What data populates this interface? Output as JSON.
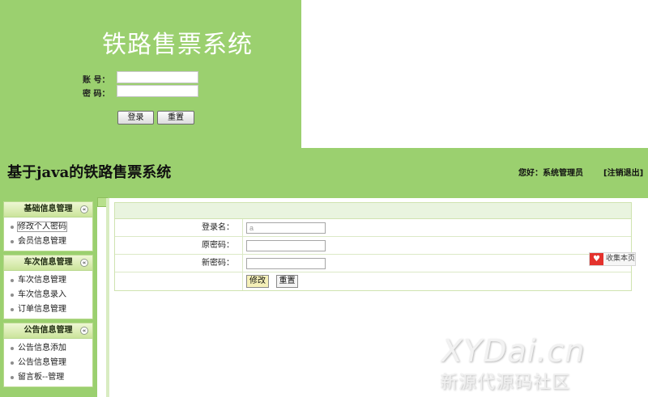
{
  "login": {
    "title": "铁路售票系统",
    "account_label": "账 号：",
    "password_label": "密 码：",
    "account_value": "",
    "password_value": "",
    "login_button": "登录",
    "reset_button": "重置"
  },
  "header": {
    "app_title": "基于java的铁路售票系统",
    "greeting": "您好：系统管理员",
    "logout": "[注销退出]"
  },
  "sidebar": {
    "groups": [
      {
        "title": "基础信息管理",
        "toggle": "«",
        "items": [
          "修改个人密码",
          "会员信息管理"
        ]
      },
      {
        "title": "车次信息管理",
        "toggle": "«",
        "items": [
          "车次信息管理",
          "车次信息录入",
          "订单信息管理"
        ]
      },
      {
        "title": "公告信息管理",
        "toggle": "«",
        "items": [
          "公告信息添加",
          "公告信息管理",
          "留言板--管理"
        ]
      }
    ]
  },
  "form": {
    "rows": [
      {
        "label": "登录名：",
        "value": "a",
        "placeholder": ""
      },
      {
        "label": "原密码：",
        "value": "",
        "placeholder": ""
      },
      {
        "label": "新密码：",
        "value": "",
        "placeholder": ""
      }
    ],
    "submit_button": "修改",
    "reset_button": "重置"
  },
  "bookmark": {
    "label": "收集本页",
    "icon": "heart-icon"
  },
  "watermark": {
    "line1": "XYDai.cn",
    "line2": "新源代源码社区"
  },
  "colors": {
    "brand_green": "#9bd06f",
    "panel_green": "#e9f4df",
    "bookmark_red": "#e4322d"
  }
}
